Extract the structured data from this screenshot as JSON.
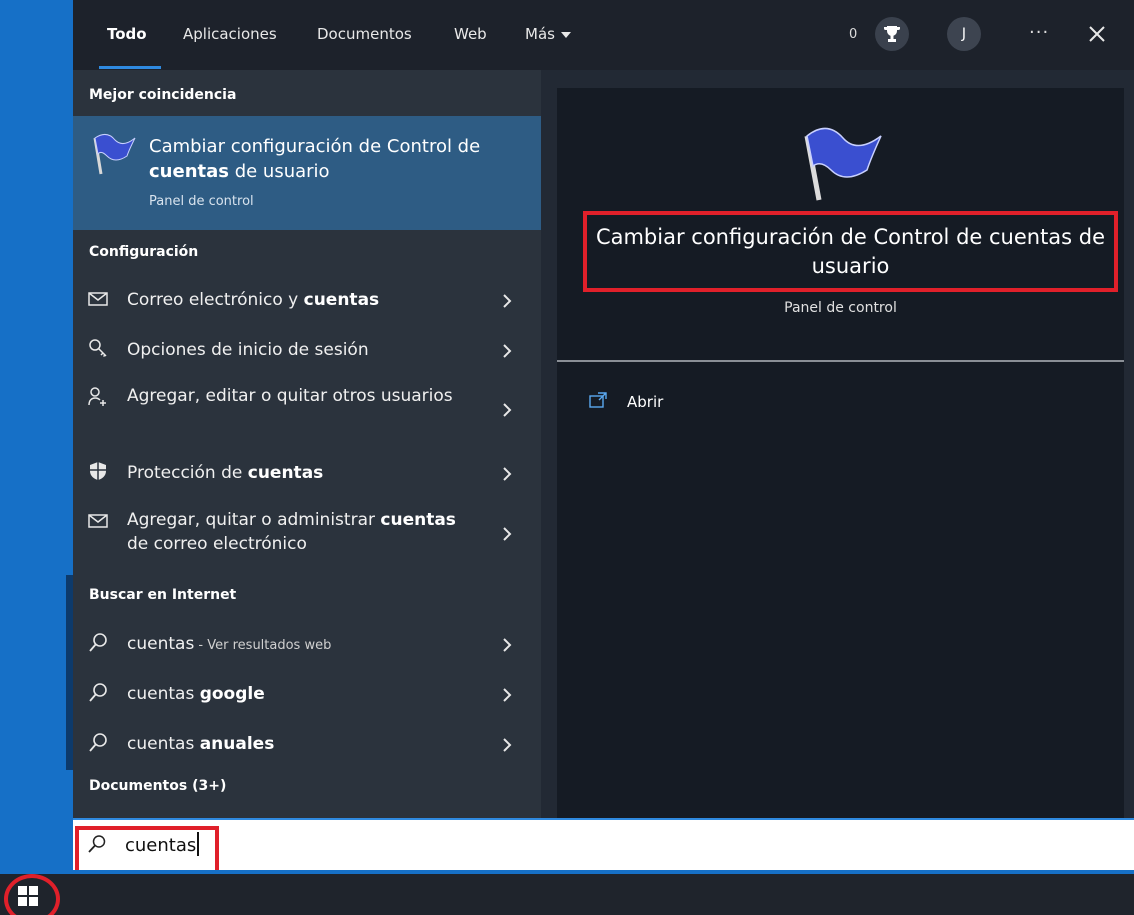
{
  "tabs": [
    {
      "label": "Todo",
      "active": true
    },
    {
      "label": "Aplicaciones"
    },
    {
      "label": "Documentos"
    },
    {
      "label": "Web"
    },
    {
      "label": "Más"
    }
  ],
  "topbar": {
    "points": "0",
    "avatar_initial": "J",
    "more": "···"
  },
  "sections": {
    "best_match": "Mejor coincidencia",
    "settings": "Configuración",
    "web": "Buscar en Internet",
    "documents": "Documentos (3+)"
  },
  "best_match": {
    "title_pre": "Cambiar configuración de Control de ",
    "title_bold": "cuentas",
    "title_post": " de usuario",
    "subtitle": "Panel de control"
  },
  "settings_items": [
    {
      "icon": "mail-icon",
      "pre": "Correo electrónico y ",
      "bold": "cuentas",
      "post": ""
    },
    {
      "icon": "key-icon",
      "pre": "Opciones de inicio de sesión",
      "bold": "",
      "post": ""
    },
    {
      "icon": "person-add-icon",
      "pre": "Agregar, editar o quitar otros usuarios",
      "bold": "",
      "post": ""
    },
    {
      "icon": "shield-icon",
      "pre": "Protección de ",
      "bold": "cuentas",
      "post": ""
    },
    {
      "icon": "mail-icon",
      "pre": "Agregar, quitar o administrar ",
      "bold": "cuentas",
      "post": " de correo electrónico"
    }
  ],
  "web_items": [
    {
      "pre": "cuentas",
      "bold": "",
      "small": " - Ver resultados web"
    },
    {
      "pre": "cuentas ",
      "bold": "google",
      "small": ""
    },
    {
      "pre": "cuentas ",
      "bold": "anuales",
      "small": ""
    }
  ],
  "preview": {
    "title": "Cambiar configuración de Control de cuentas de usuario",
    "subtitle": "Panel de control",
    "open_label": "Abrir"
  },
  "search": {
    "value": "cuentas"
  },
  "colors": {
    "accent": "#2f8ae0",
    "highlight": "#e0202a",
    "selected": "#2e5c84"
  }
}
